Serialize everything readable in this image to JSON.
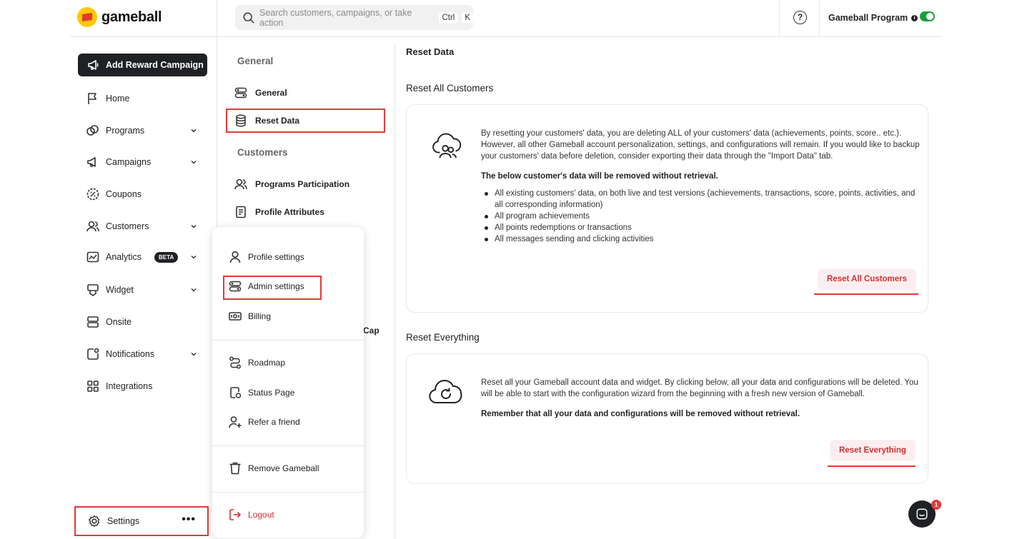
{
  "brand": {
    "name": "gameball"
  },
  "search": {
    "placeholder": "Search customers, campaigns, or take action",
    "shortcut_ctrl": "Ctrl",
    "shortcut_key": "K"
  },
  "header": {
    "program_name": "Gameball Program",
    "help_label": "?"
  },
  "sidebar": {
    "cta_label": "Add Reward Campaign",
    "items": [
      {
        "label": "Home"
      },
      {
        "label": "Programs"
      },
      {
        "label": "Campaigns"
      },
      {
        "label": "Coupons"
      },
      {
        "label": "Customers"
      },
      {
        "label": "Analytics",
        "badge": "BETA"
      },
      {
        "label": "Widget"
      },
      {
        "label": "Onsite"
      },
      {
        "label": "Notifications"
      },
      {
        "label": "Integrations"
      }
    ],
    "settings_label": "Settings",
    "more_label": "•••"
  },
  "settings_nav": {
    "section_general": "General",
    "general_label": "General",
    "reset_data_label": "Reset Data",
    "section_customers": "Customers",
    "programs_participation_label": "Programs Participation",
    "profile_attributes_label": "Profile Attributes",
    "partial_label": "Cap"
  },
  "user_menu": {
    "profile_settings": "Profile settings",
    "admin_settings": "Admin settings",
    "billing": "Billing",
    "roadmap": "Roadmap",
    "status_page": "Status Page",
    "refer_friend": "Refer a friend",
    "remove_gameball": "Remove Gameball",
    "logout": "Logout"
  },
  "main": {
    "title": "Reset Data",
    "reset_customers": {
      "heading": "Reset All Customers",
      "description": "By resetting your customers' data, you are deleting ALL of your customers' data (achievements, points, score.. etc.). However, all other Gameball account personalization, settings, and configurations will remain. If you would like to backup your customers' data before deletion, consider exporting their data through the \"Import Data\" tab.",
      "warning": "The below customer's data will be removed without retrieval.",
      "bullets": [
        "All existing customers' data, on both live and test versions (achievements, transactions, score, points, activities, and all corresponding information)",
        "All program achievements",
        "All points redemptions or transactions",
        "All messages sending and clicking activities"
      ],
      "button": "Reset All Customers"
    },
    "reset_everything": {
      "heading": "Reset Everything",
      "description": "Reset all your Gameball account data and widget. By clicking below, all your data and configurations will be deleted. You will be able to start with the configuration wizard from the beginning with a fresh new version of Gameball.",
      "warning": "Remember that all your data and configurations will be removed without retrieval.",
      "button": "Reset Everything"
    }
  },
  "chat": {
    "badge_count": "1"
  },
  "colors": {
    "accent_red": "#e53935",
    "dark": "#1f2124",
    "toggle_on": "#1a9d3a"
  }
}
